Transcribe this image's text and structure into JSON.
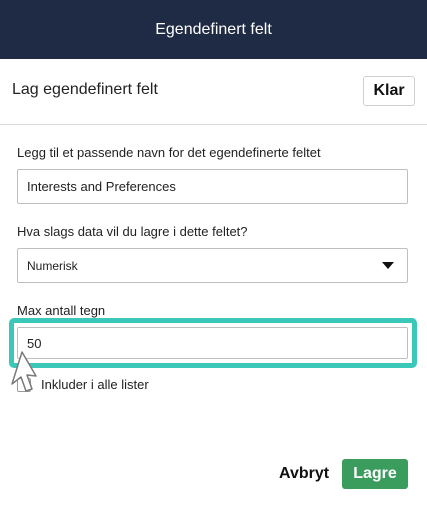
{
  "header": {
    "title": "Egendefinert felt"
  },
  "subheader": {
    "title": "Lag egendefinert felt",
    "done_label": "Klar"
  },
  "form": {
    "name_label": "Legg til et passende navn for det egendefinerte feltet",
    "name_value": "Interests and Preferences",
    "type_label": "Hva slags data vil du lagre i dette feltet?",
    "type_value": "Numerisk",
    "max_label": "Max antall tegn",
    "max_value": "50",
    "include_label": "Inkluder i alle lister",
    "include_checked": false
  },
  "footer": {
    "cancel_label": "Avbryt",
    "save_label": "Lagre"
  },
  "colors": {
    "header_bg": "#1f2a44",
    "highlight": "#3cc8b8",
    "save_bg": "#3a9d5d"
  },
  "icons": {
    "select": "chevron-down-icon",
    "pointer": "mouse-pointer-icon"
  }
}
